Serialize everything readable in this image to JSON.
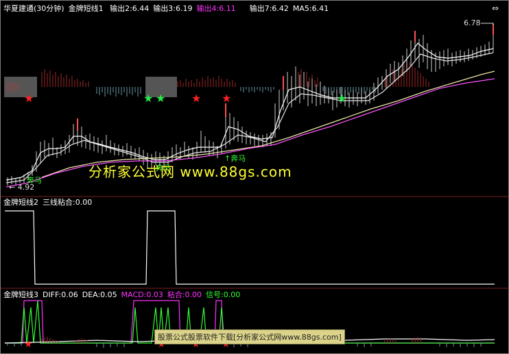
{
  "panel1": {
    "header": {
      "stock": "华夏建通(30分钟)",
      "indicator": "金牌短线1",
      "out2": "输出2:6.44",
      "out3": "输出3:6.19",
      "out4": "输出4:6.11",
      "out7": "输出7:6.42",
      "ma5": "MA5:6.41"
    },
    "price_high_label": "6.78",
    "price_low_label": "← 4.92",
    "signal_labels": [
      "奔马",
      "奔马",
      "↑奔马"
    ],
    "watermark": "分析家公式网 www.88gs.com"
  },
  "panel2": {
    "header": {
      "indicator": "金牌短线2",
      "value": "三线粘合:0.00"
    }
  },
  "panel3": {
    "header": {
      "indicator": "金牌短线3",
      "diff": "DIFF:0.06",
      "dea": "DEA:0.05",
      "macd": "MACD:0.03",
      "nianhe": "粘合:0.00",
      "xinhao": "信号:0.00"
    },
    "banner": "股票公式股票软件下载[分析家公式网www.88gs.com]"
  },
  "colors": {
    "header_white": "#ffffff",
    "magenta": "#ff33ff",
    "green": "#33ff33",
    "red_star": "#ff2020",
    "green_star": "#22ee44",
    "yellow": "#ffff33"
  }
}
